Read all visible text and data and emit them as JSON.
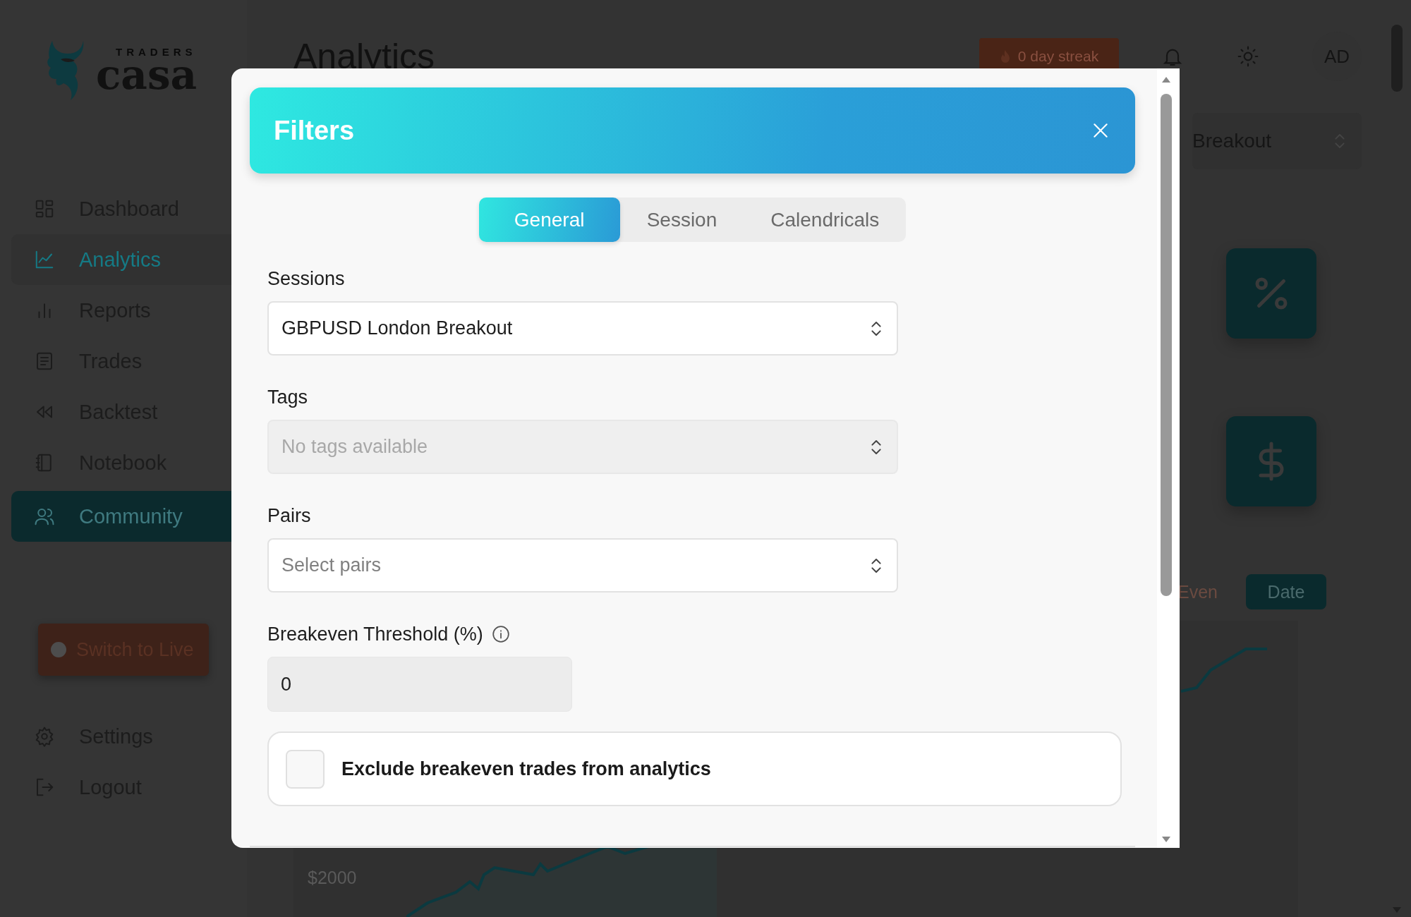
{
  "logo": {
    "small": "TRADERS",
    "big": "casa"
  },
  "sidebar": {
    "items": [
      {
        "label": "Dashboard",
        "selected": false,
        "hovered": false
      },
      {
        "label": "Analytics",
        "selected": true,
        "hovered": false
      },
      {
        "label": "Reports",
        "selected": false,
        "hovered": false
      },
      {
        "label": "Trades",
        "selected": false,
        "hovered": false
      },
      {
        "label": "Backtest",
        "selected": false,
        "hovered": false
      },
      {
        "label": "Notebook",
        "selected": false,
        "hovered": false
      },
      {
        "label": "Community",
        "selected": false,
        "hovered": true
      }
    ],
    "switch_button": "Switch to Live",
    "bottom_items": [
      {
        "label": "Settings"
      },
      {
        "label": "Logout"
      }
    ]
  },
  "header": {
    "title": "Analytics",
    "streak": "0 day streak",
    "avatar": "AD"
  },
  "session_select": "Breakout",
  "chart_options": [
    {
      "label": "Even",
      "selected": false
    },
    {
      "label": "Date",
      "selected": true
    }
  ],
  "chart": {
    "y_label": "$2000"
  },
  "modal": {
    "title": "Filters",
    "tabs": [
      {
        "label": "General",
        "selected": true
      },
      {
        "label": "Session",
        "selected": false
      },
      {
        "label": "Calendricals",
        "selected": false
      }
    ],
    "fields": [
      {
        "kind": "select",
        "label": "Sessions",
        "value": "GBPUSD London Breakout",
        "disabled": false
      },
      {
        "kind": "select",
        "label": "Tags",
        "placeholder": "No tags available",
        "disabled": true
      },
      {
        "kind": "select",
        "label": "Pairs",
        "placeholder": "Select pairs",
        "disabled": false
      },
      {
        "kind": "number",
        "label": "Breakeven Threshold (%)",
        "info": true,
        "value": "0",
        "disabled": false
      }
    ],
    "exclude": {
      "label": "Exclude breakeven trades from analytics",
      "checked": false
    }
  }
}
